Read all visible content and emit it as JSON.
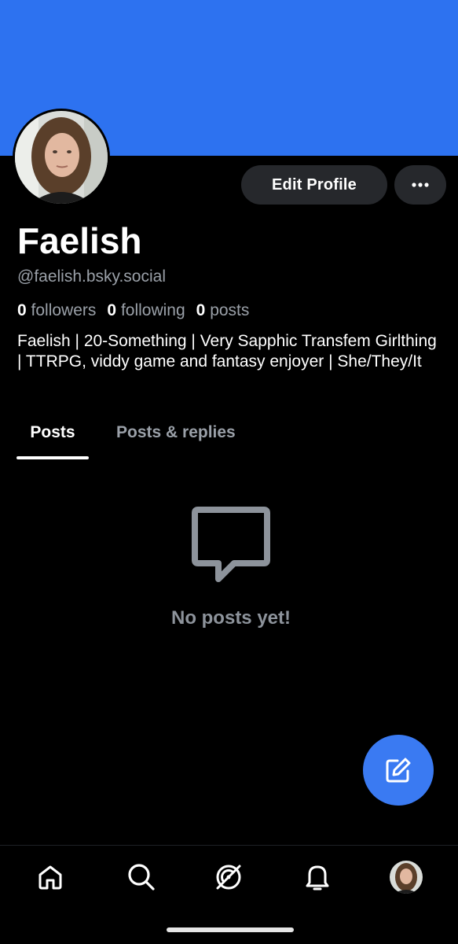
{
  "colors": {
    "banner": "#2d72f0",
    "background": "#000000",
    "button_bg": "#26282c",
    "fab": "#3a7af2",
    "muted_text": "#9aa0a8"
  },
  "profile": {
    "display_name": "Faelish",
    "handle": "@faelish.bsky.social",
    "bio": "Faelish | 20-Something | Very Sapphic Transfem Girlthing | TTRPG, viddy game and fantasy enjoyer | She/They/It",
    "edit_label": "Edit Profile",
    "stats": {
      "followers_count": "0",
      "followers_label": "followers",
      "following_count": "0",
      "following_label": "following",
      "posts_count": "0",
      "posts_label": "posts"
    }
  },
  "tabs": [
    {
      "label": "Posts",
      "active": true
    },
    {
      "label": "Posts & replies",
      "active": false
    }
  ],
  "empty_state": {
    "icon": "message-bubble-icon",
    "text": "No posts yet!"
  },
  "fab": {
    "icon": "compose-icon"
  },
  "bottom_nav": [
    {
      "icon": "home-icon"
    },
    {
      "icon": "search-icon"
    },
    {
      "icon": "feeds-icon"
    },
    {
      "icon": "notifications-bell-icon"
    },
    {
      "icon": "profile-avatar"
    }
  ]
}
